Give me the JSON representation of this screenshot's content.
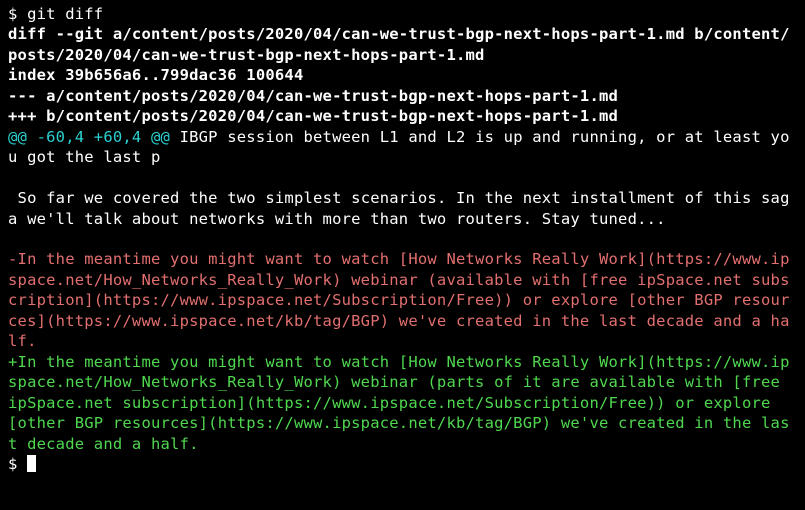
{
  "prompt_symbol": "$ ",
  "command": "git diff",
  "diff_header_1": "diff --git a/content/posts/2020/04/can-we-trust-bgp-next-hops-part-1.md b/content/posts/2020/04/can-we-trust-bgp-next-hops-part-1.md",
  "diff_header_2": "index 39b656a6..799dac36 100644",
  "diff_header_3": "--- a/content/posts/2020/04/can-we-trust-bgp-next-hops-part-1.md",
  "diff_header_4": "+++ b/content/posts/2020/04/can-we-trust-bgp-next-hops-part-1.md",
  "hunk_marker": "@@ -60,4 +60,4 @@",
  "hunk_context": " IBGP session between L1 and L2 is up and running, or at least you got the last p",
  "context_blank": " ",
  "context_line": " So far we covered the two simplest scenarios. In the next installment of this saga we'll talk about networks with more than two routers. Stay tuned...",
  "removed_line": "-In the meantime you might want to watch [How Networks Really Work](https://www.ipspace.net/How_Networks_Really_Work) webinar (available with [free ipSpace.net subscription](https://www.ipspace.net/Subscription/Free)) or explore [other BGP resources](https://www.ipspace.net/kb/tag/BGP) we've created in the last decade and a half.",
  "added_line": "+In the meantime you might want to watch [How Networks Really Work](https://www.ipspace.net/How_Networks_Really_Work) webinar (parts of it are available with [free ipSpace.net subscription](https://www.ipspace.net/Subscription/Free)) or explore [other BGP resources](https://www.ipspace.net/kb/tag/BGP) we've created in the last decade and a half.",
  "trailing_prompt": "$ "
}
